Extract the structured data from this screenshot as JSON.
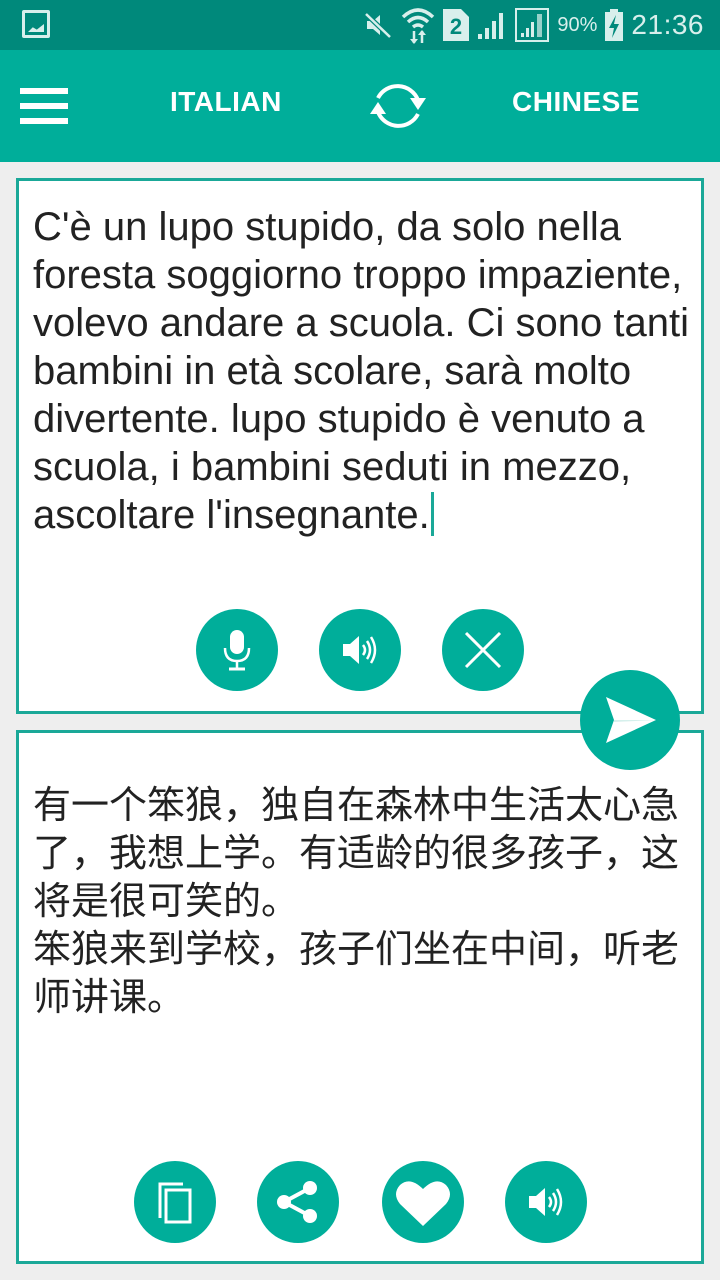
{
  "status_bar": {
    "notification_icon": "gallery-icon",
    "icons": [
      "mute-icon",
      "wifi-icon",
      "sim-2-icon",
      "signal-icon",
      "signal-roaming-icon",
      "battery-charging-icon"
    ],
    "sim_label": "2",
    "battery": "90%",
    "time": "21:36"
  },
  "toolbar": {
    "menu_icon": "hamburger-menu-icon",
    "source_language": "ITALIAN",
    "swap_icon": "swap-languages-icon",
    "target_language": "CHINESE"
  },
  "input_card": {
    "text": "C'è un lupo stupido, da solo nella foresta soggiorno troppo impaziente, volevo andare a scuola. Ci sono tanti bambini in età scolare, sarà molto divertente. lupo stupido è venuto a scuola, i bambini seduti in mezzo, ascoltare l'insegnante.",
    "buttons": [
      {
        "name": "microphone",
        "icon": "microphone-icon"
      },
      {
        "name": "speak-source",
        "icon": "speaker-icon"
      },
      {
        "name": "clear",
        "icon": "close-icon"
      }
    ]
  },
  "send_button": {
    "icon": "send-icon"
  },
  "output_card": {
    "text": "有一个笨狼，独自在森林中生活太心急了，我想上学。有适龄的很多孩子，这将是很可笑的。\n笨狼来到学校，孩子们坐在中间，听老师讲课。",
    "buttons": [
      {
        "name": "copy",
        "icon": "copy-icon"
      },
      {
        "name": "share",
        "icon": "share-icon"
      },
      {
        "name": "favorite",
        "icon": "heart-icon"
      },
      {
        "name": "speak-target",
        "icon": "speaker-icon"
      }
    ]
  },
  "colors": {
    "status_bar": "#00897b",
    "primary": "#00ae9a",
    "card_border": "#1aa898",
    "background": "#eeeeee"
  }
}
